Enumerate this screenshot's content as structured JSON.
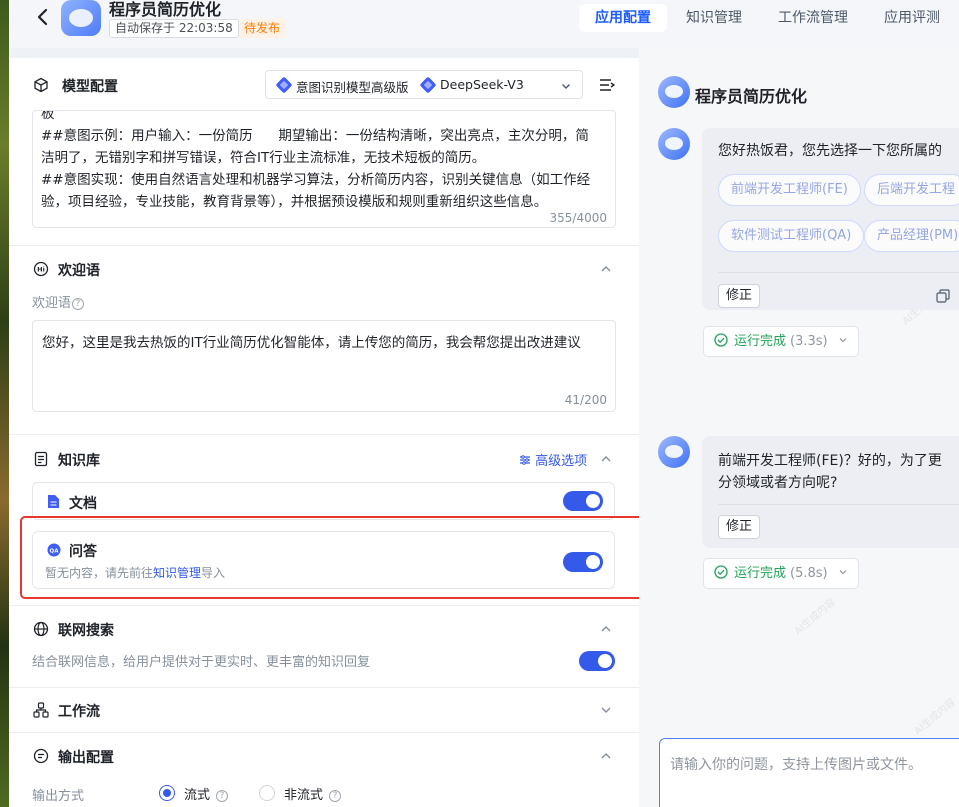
{
  "header": {
    "app_name": "程序员简历优化",
    "autosave": "自动保存于 22:03:58",
    "status_badge": "待发布",
    "tabs": [
      {
        "label": "应用配置",
        "active": true
      },
      {
        "label": "知识管理",
        "active": false
      },
      {
        "label": "工作流管理",
        "active": false
      },
      {
        "label": "应用评测",
        "active": false
      }
    ]
  },
  "model_config": {
    "title": "模型配置",
    "intent_model": "意图识别模型高级版",
    "llm_model": "DeepSeek-V3",
    "prompt_text": "板\n##意图示例：用户输入：一份简历      期望输出：一份结构清晰，突出亮点，主次分明，简洁明了，无错别字和拼写错误，符合IT行业主流标准，无技术短板的简历。\n##意图实现：使用自然语言处理和机器学习算法，分析简历内容，识别关键信息（如工作经验，项目经验，专业技能，教育背景等），并根据预设模版和规则重新组织这些信息。",
    "prompt_counter": "355/4000"
  },
  "welcome": {
    "title": "欢迎语",
    "field_label": "欢迎语",
    "text": "您好，这里是我去热饭的IT行业简历优化智能体，请上传您的简历，我会帮您提出改进建议",
    "counter": "41/200"
  },
  "knowledge": {
    "title": "知识库",
    "advanced": "高级选项",
    "doc_label": "文档",
    "qa_label": "问答",
    "qa_hint_prefix": "暂无内容，请先前往",
    "qa_hint_link": "知识管理",
    "qa_hint_suffix": "导入",
    "doc_enabled": true,
    "qa_enabled": true
  },
  "web_search": {
    "title": "联网搜索",
    "desc": "结合联网信息，给用户提供对于更实时、更丰富的知识回复",
    "enabled": true
  },
  "workflow": {
    "title": "工作流"
  },
  "output": {
    "title": "输出配置",
    "mode_label": "输出方式",
    "stream": "流式",
    "non_stream": "非流式",
    "selected": "流式"
  },
  "preview": {
    "title": "程序员简历优化",
    "msg1": "您好热饭君，您先选择一下您所属的",
    "options": [
      "前端开发工程师(FE)",
      "后端开发工程",
      "软件测试工程师(QA)",
      "产品经理(PM)"
    ],
    "fix_label": "修正",
    "run1_status": "运行完成",
    "run1_time": "(3.3s)",
    "msg2_line1": "前端开发工程师(FE)？好的，为了更",
    "msg2_line2": "分领域或者方向呢?",
    "run2_status": "运行完成",
    "run2_time": "(5.8s)",
    "input_placeholder": "请输入你的问题，支持上传图片或文件。"
  }
}
